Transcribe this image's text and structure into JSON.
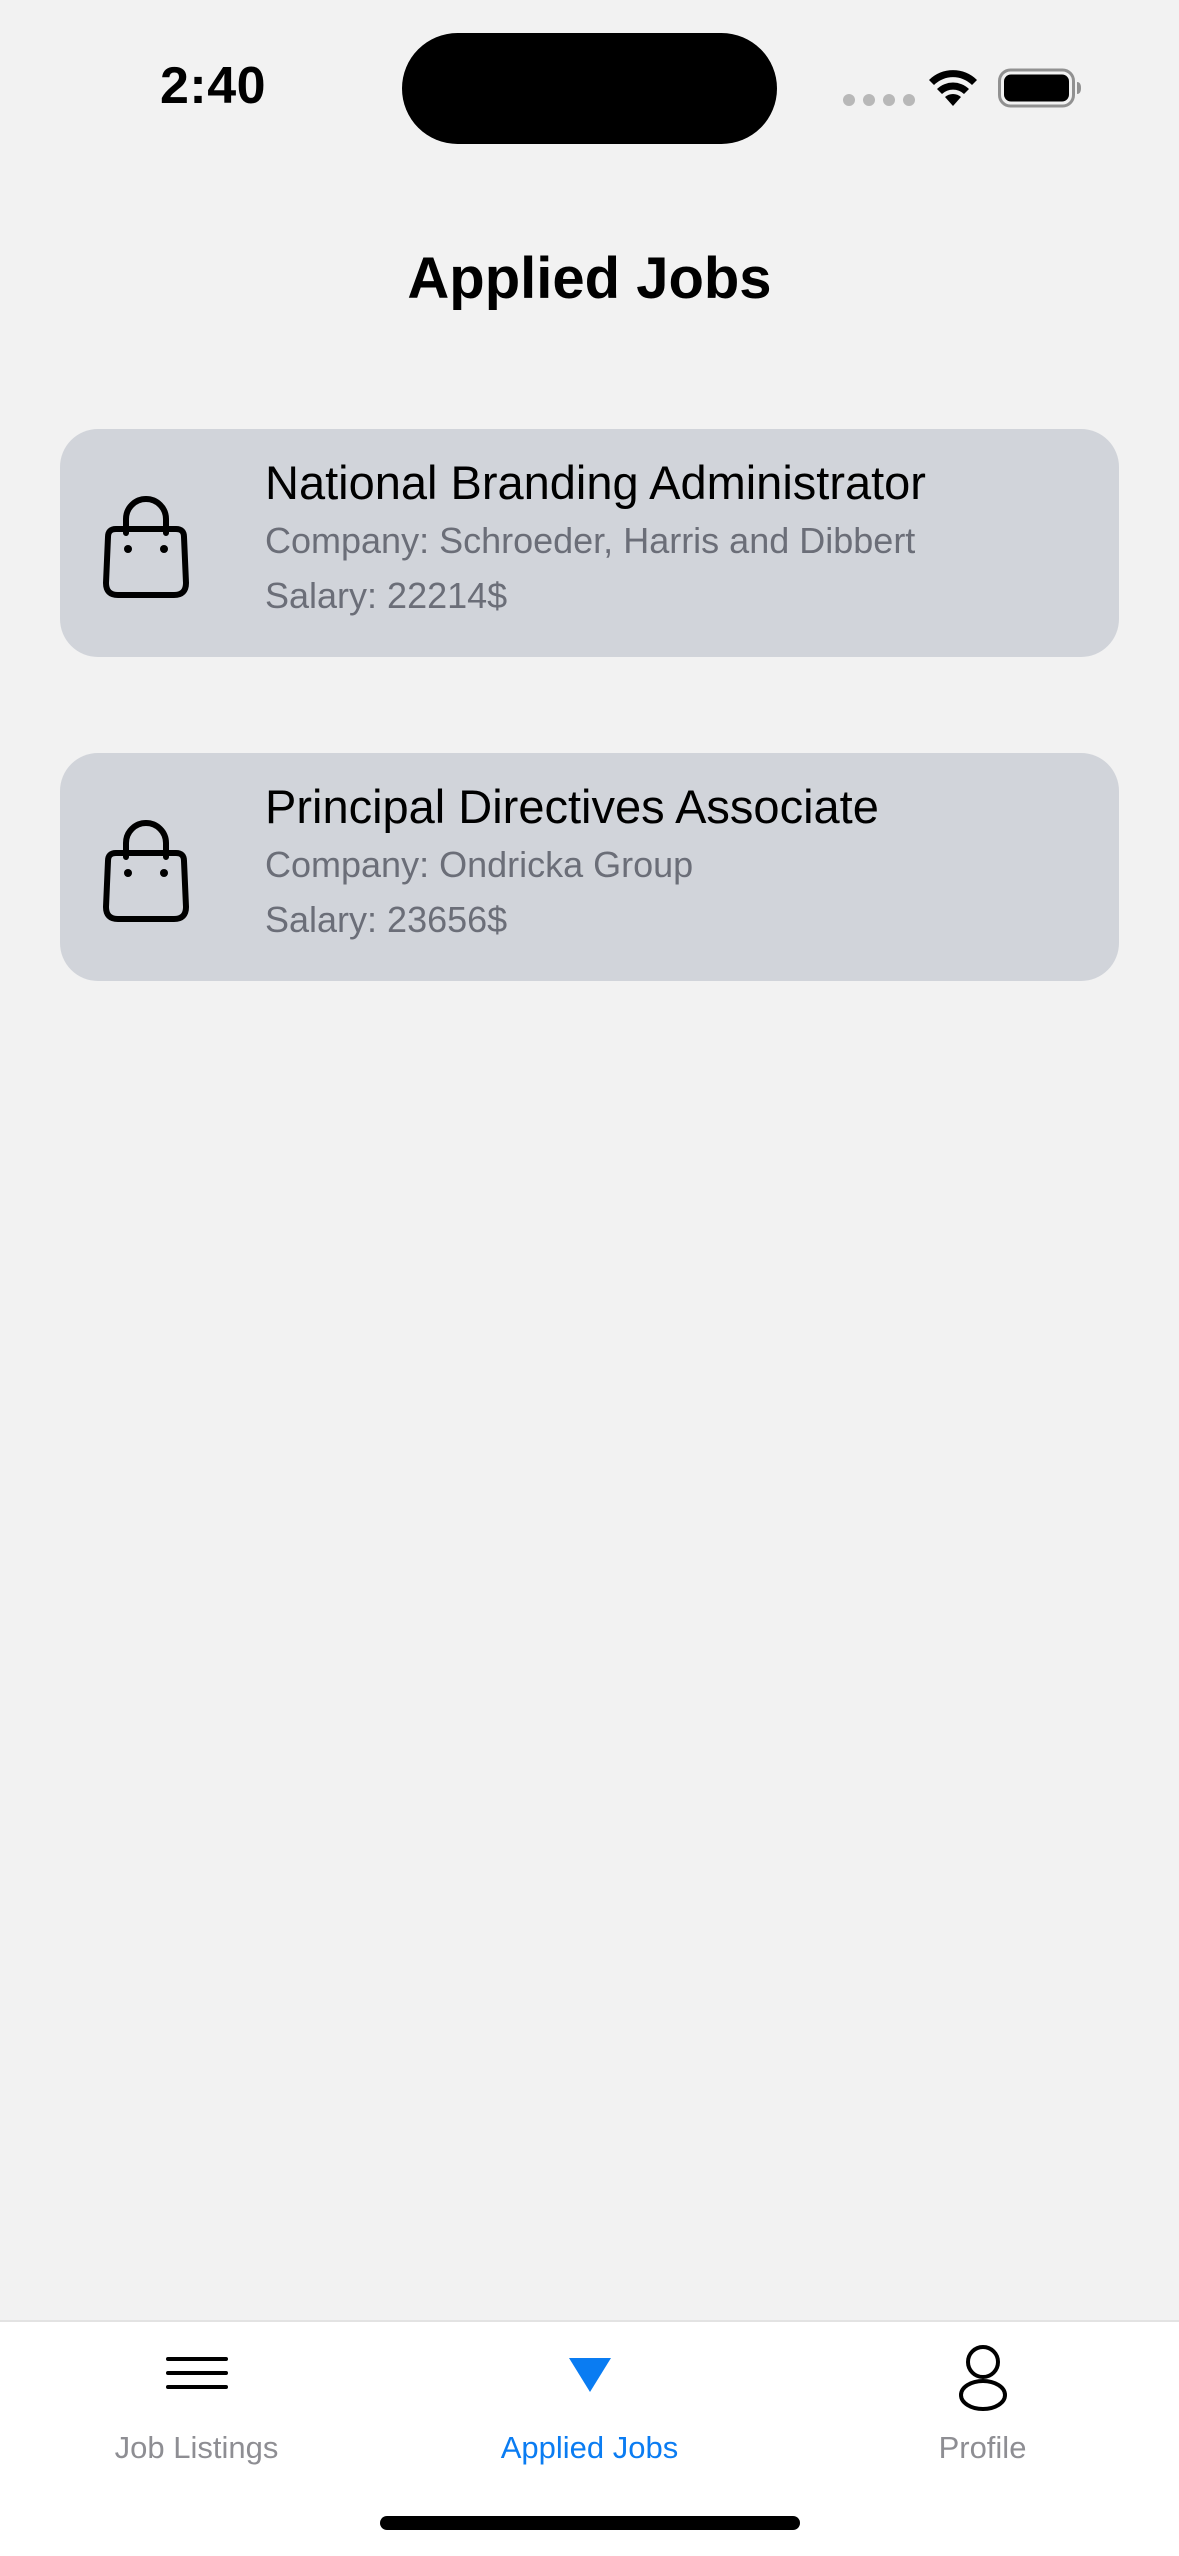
{
  "status_bar": {
    "time": "2:40"
  },
  "page": {
    "title": "Applied Jobs"
  },
  "jobs": [
    {
      "title": "National Branding Administrator",
      "company": "Company: Schroeder, Harris and Dibbert",
      "salary": "Salary: 22214$",
      "icon": "shopping-bag-icon"
    },
    {
      "title": "Principal Directives Associate",
      "company": "Company: Ondricka Group",
      "salary": "Salary: 23656$",
      "icon": "shopping-bag-icon"
    }
  ],
  "tab_bar": {
    "tabs": [
      {
        "label": "Job Listings",
        "icon": "menu-icon",
        "active": false
      },
      {
        "label": "Applied Jobs",
        "icon": "triangle-down-icon",
        "active": true
      },
      {
        "label": "Profile",
        "icon": "person-icon",
        "active": false
      }
    ],
    "active_color": "#0a7cf2",
    "inactive_color": "#8e8e93"
  },
  "colors": {
    "background": "#f2f2f2",
    "card": "#d1d4da",
    "secondary_text": "#6b6e78"
  }
}
